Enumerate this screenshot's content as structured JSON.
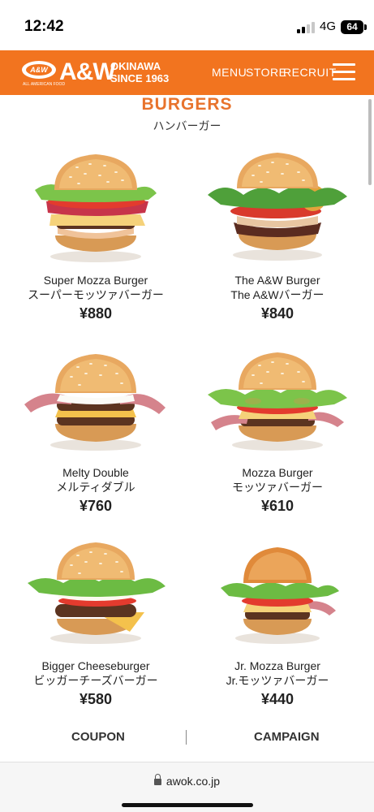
{
  "status_bar": {
    "time": "12:42",
    "network": "4G",
    "battery": "64"
  },
  "header": {
    "logo": {
      "badge": "A&W",
      "tagline": "ALL AMERICAN FOOD",
      "wordmark": "A&W",
      "region": "OKINAWA",
      "since": "SINCE 1963"
    },
    "nav": {
      "menu": "MENU",
      "store": "STORE",
      "recruit": "RECRUIT"
    }
  },
  "section": {
    "title": "BURGERS",
    "subtitle": "ハンバーガー"
  },
  "items": [
    {
      "name": "Super Mozza Burger",
      "name_jp": "スーパーモッツァバーガー",
      "price": "¥880"
    },
    {
      "name": "The A&W Burger",
      "name_jp": "The A&Wバーガー",
      "price": "¥840"
    },
    {
      "name": "Melty Double",
      "name_jp": "メルティダブル",
      "price": "¥760"
    },
    {
      "name": "Mozza Burger",
      "name_jp": "モッツァバーガー",
      "price": "¥610"
    },
    {
      "name": "Bigger Cheeseburger",
      "name_jp": "ビッガーチーズバーガー",
      "price": "¥580"
    },
    {
      "name": "Jr. Mozza Burger",
      "name_jp": "Jr.モッツァバーガー",
      "price": "¥440"
    }
  ],
  "footer": {
    "coupon": "COUPON",
    "campaign": "CAMPAIGN"
  },
  "browser": {
    "url": "awok.co.jp"
  },
  "colors": {
    "brand_orange": "#f2741f",
    "title_orange": "#e8732c"
  },
  "icons": [
    "signal-icon",
    "battery-icon",
    "hamburger-menu-icon",
    "lock-icon"
  ]
}
